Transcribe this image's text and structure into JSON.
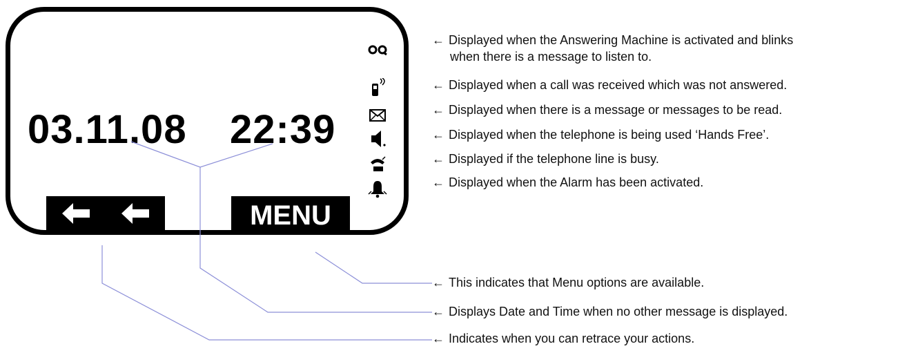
{
  "display": {
    "date": "03.11.08",
    "time": "22:39",
    "back_arrows": [
      "🡐",
      "🡐"
    ],
    "menu_label": "MENU"
  },
  "icons": [
    {
      "name": "answering-machine-icon"
    },
    {
      "name": "missed-call-icon"
    },
    {
      "name": "envelope-icon"
    },
    {
      "name": "speaker-icon"
    },
    {
      "name": "line-busy-icon"
    },
    {
      "name": "alarm-bell-icon"
    }
  ],
  "annotations": {
    "arrow": "←",
    "answering_machine_1": "Displayed when the Answering Machine is activated and blinks",
    "answering_machine_2": "when there is a message to listen to.",
    "missed_call": "Displayed when a call was received which was not answered.",
    "message": "Displayed when there is a message or messages to be read.",
    "hands_free": "Displayed when the telephone is being used ‘Hands Free’.",
    "line_busy": "Displayed if the telephone line is busy.",
    "alarm": "Displayed when the Alarm has been activated.",
    "menu": "This indicates that Menu options are available.",
    "date_time": "Displays Date and Time when no other message is displayed.",
    "retrace": "Indicates when you can retrace your actions."
  },
  "colors": {
    "leader_line": "#8c8fd8",
    "lcd_border": "#000000"
  }
}
